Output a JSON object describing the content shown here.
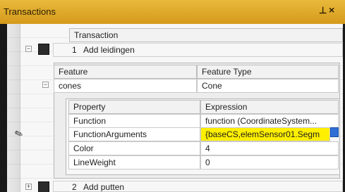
{
  "window": {
    "title": "Transactions",
    "pin_icon": "pin-icon",
    "close_icon": "close-icon"
  },
  "transactions": {
    "column_header": "Transaction",
    "rows": [
      {
        "index": "1",
        "label": "Add leidingen"
      },
      {
        "index": "2",
        "label": "Add putten"
      }
    ]
  },
  "features": {
    "headers": {
      "feature": "Feature",
      "type": "Feature Type"
    },
    "row": {
      "feature": "cones",
      "type": "Cone"
    }
  },
  "properties": {
    "headers": {
      "property": "Property",
      "expression": "Expression"
    },
    "rows": [
      {
        "property": "Function",
        "expression": "function (CoordinateSystem..."
      },
      {
        "property": "FunctionArguments",
        "expression": "{baseCS,elemSensor01.Segm"
      },
      {
        "property": "Color",
        "expression": "4"
      },
      {
        "property": "LineWeight",
        "expression": "0"
      }
    ]
  },
  "colors": {
    "title_bar": "#d9a021",
    "highlight": "#ffef00"
  }
}
